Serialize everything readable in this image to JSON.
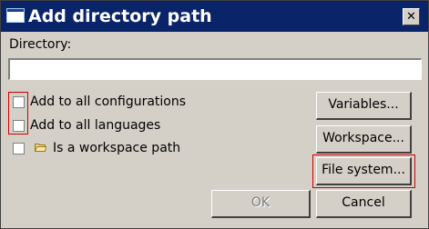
{
  "window": {
    "title": "Add directory path",
    "close_glyph": "✕"
  },
  "directory": {
    "label": "Directory:",
    "value": "",
    "placeholder": ""
  },
  "options": {
    "all_configurations": {
      "label": "Add to all configurations",
      "checked": false
    },
    "all_languages": {
      "label": "Add to all languages",
      "checked": false
    },
    "workspace_path": {
      "label": "Is a workspace path",
      "checked": false,
      "icon": "folder-icon"
    }
  },
  "buttons": {
    "variables": "Variables...",
    "workspace": "Workspace...",
    "file_system": "File system...",
    "ok": "OK",
    "cancel": "Cancel"
  },
  "colors": {
    "titlebar": "#0a246a",
    "face": "#d4d0c8",
    "highlight_box": "#cc0000"
  }
}
